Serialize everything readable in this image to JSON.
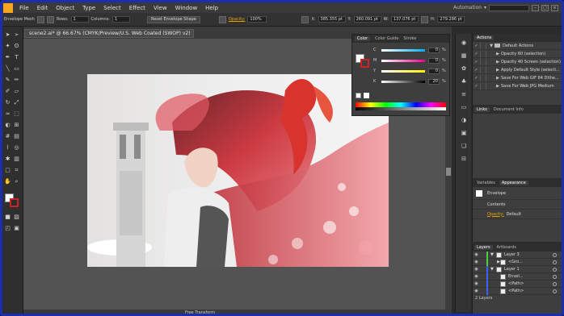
{
  "menubar": {
    "items": [
      "File",
      "Edit",
      "Object",
      "Type",
      "Select",
      "Effect",
      "View",
      "Window",
      "Help"
    ],
    "workspace": "Automation"
  },
  "controlbar": {
    "tool_label": "Envelope Mesh",
    "rows_label": "Rows:",
    "rows_value": "1",
    "columns_label": "Columns:",
    "columns_value": "1",
    "reset_button": "Reset Envelope Shape",
    "opacity_label": "Opacity:",
    "opacity_value": "100%",
    "x_value": "385.355 pt",
    "y_value": "260.091 pt",
    "w_value": "137.076 pt",
    "h_value": "279.286 pt"
  },
  "document": {
    "tab_title": "scene2.ai* @ 66.67% (CMYK/Preview/U.S. Web Coated (SWOP) v2)",
    "status_text": "Free Transform"
  },
  "color_panel": {
    "tabs": [
      "Color",
      "Color Guide",
      "Stroke"
    ],
    "channels": [
      {
        "label": "C",
        "value": "0",
        "color": "#00aeef"
      },
      {
        "label": "M",
        "value": "0",
        "color": "#ec008c"
      },
      {
        "label": "Y",
        "value": "0",
        "color": "#fff200"
      },
      {
        "label": "K",
        "value": "20",
        "color": "#222222"
      }
    ],
    "percent_sign": "%"
  },
  "actions_panel": {
    "tab": "Actions",
    "rows": [
      {
        "label": "Default Actions",
        "folder": true
      },
      {
        "label": "Opacity 60 (selection)"
      },
      {
        "label": "Opacity 40 Screen (selection)"
      },
      {
        "label": "Apply Default Style (selecti..."
      },
      {
        "label": "Save For Web GIF 64 Dithe..."
      },
      {
        "label": "Save For Web JPG Medium"
      }
    ]
  },
  "links_panel": {
    "tabs": [
      "Links",
      "Document Info"
    ]
  },
  "appearance_panel": {
    "tabs": [
      "Variables",
      "Appearance"
    ],
    "rows": [
      {
        "label": "Envelope"
      },
      {
        "label": "Contents"
      },
      {
        "label": "Opacity:",
        "value": "Default"
      }
    ]
  },
  "layers_panel": {
    "tabs": [
      "Layers",
      "Artboards"
    ],
    "rows": [
      {
        "label": "Layer 3",
        "color": "#4fcf3f"
      },
      {
        "label": "<Gro...",
        "color": "#4fcf3f"
      },
      {
        "label": "Layer 1",
        "color": "#3f5fff"
      },
      {
        "label": "Envel...",
        "color": "#3f5fff"
      },
      {
        "label": "<Path>",
        "color": "#3f5fff"
      },
      {
        "label": "<Path>",
        "color": "#3f5fff"
      }
    ],
    "footer": "2 Layers"
  },
  "colors": {
    "accent_orange": "#f6a623",
    "selection_blue": "#1a2fb0",
    "artwork_red": "#c8262e"
  }
}
